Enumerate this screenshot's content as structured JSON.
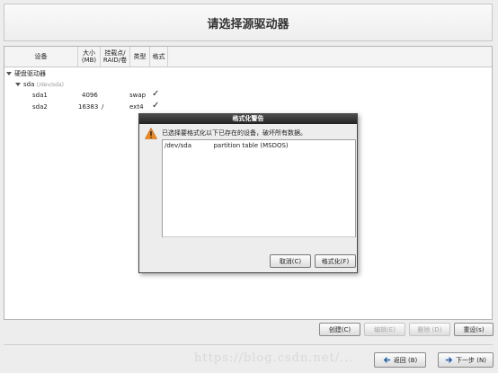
{
  "header": {
    "title": "请选择源驱动器"
  },
  "columns": {
    "device": "设备",
    "size": "大小\n(MB)",
    "mount": "挂载点/\nRAID/卷",
    "type": "类型",
    "format": "格式"
  },
  "tree": {
    "group_label": "硬盘驱动器",
    "disk_name": "sda",
    "disk_path": "(/dev/sda)",
    "partitions": [
      {
        "name": "sda1",
        "size": "4096",
        "mount": "",
        "type": "swap",
        "format_mark": "✓"
      },
      {
        "name": "sda2",
        "size": "16383",
        "mount": "/",
        "type": "ext4",
        "format_mark": "✓"
      }
    ]
  },
  "dialog": {
    "title": "格式化警告",
    "message": "已选择要格式化以下已存在的设备，破坏所有数据。",
    "list": {
      "device": "/dev/sda",
      "description": "partition table (MSDOS)"
    },
    "cancel_label": "取消(C)",
    "format_label": "格式化(F)"
  },
  "actions": {
    "create": "创建(C)",
    "edit": "编辑(E)",
    "delete": "删除 (D)",
    "reset": "重设(s)"
  },
  "nav": {
    "back": "返回 (B)",
    "next": "下一步 (N)"
  },
  "watermark": "https://blog.csdn.net/..."
}
